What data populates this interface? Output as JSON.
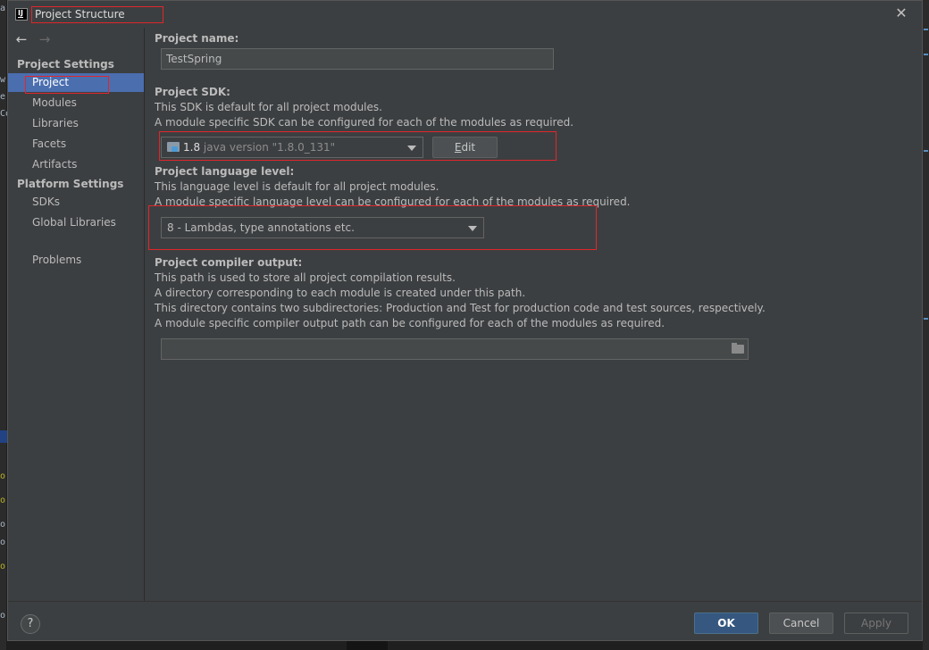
{
  "background": {
    "left_fragments": [
      "a",
      "w",
      "e",
      "Co",
      "o",
      "o",
      "o",
      "o",
      "o",
      "o"
    ]
  },
  "dialog": {
    "title": "Project Structure",
    "app_icon_text": "IJ",
    "close_glyph": "✕"
  },
  "sidebar": {
    "back_glyph": "←",
    "forward_glyph": "→",
    "project_settings_heading": "Project Settings",
    "project_settings_items": [
      "Project",
      "Modules",
      "Libraries",
      "Facets",
      "Artifacts"
    ],
    "platform_settings_heading": "Platform Settings",
    "platform_settings_items": [
      "SDKs",
      "Global Libraries"
    ],
    "other_items": [
      "Problems"
    ],
    "active_item": "Project"
  },
  "main": {
    "project_name": {
      "label": "Project name:",
      "value": "TestSpring"
    },
    "project_sdk": {
      "label": "Project SDK:",
      "desc_line1": "This SDK is default for all project modules.",
      "desc_line2": "A module specific SDK can be configured for each of the modules as required.",
      "selected_version": "1.8",
      "selected_desc": "java version \"1.8.0_131\"",
      "edit_label_first": "E",
      "edit_label_rest": "dit"
    },
    "language_level": {
      "label": "Project language level:",
      "desc_line1": "This language level is default for all project modules.",
      "desc_line2": "A module specific language level can be configured for each of the modules as required.",
      "selected": "8 - Lambdas, type annotations etc."
    },
    "compiler_output": {
      "label": "Project compiler output:",
      "desc_line1": "This path is used to store all project compilation results.",
      "desc_line2": "A directory corresponding to each module is created under this path.",
      "desc_line3": "This directory contains two subdirectories: Production and Test for production code and test sources, respectively.",
      "desc_line4": "A module specific compiler output path can be configured for each of the modules as required.",
      "value": ""
    }
  },
  "footer": {
    "help_glyph": "?",
    "ok_label": "OK",
    "cancel_label": "Cancel",
    "apply_label": "Apply"
  },
  "colors": {
    "dialog_bg": "#3c3f41",
    "selection": "#4b6eaf",
    "ok_button": "#365880",
    "highlight_border": "#e0262b"
  }
}
